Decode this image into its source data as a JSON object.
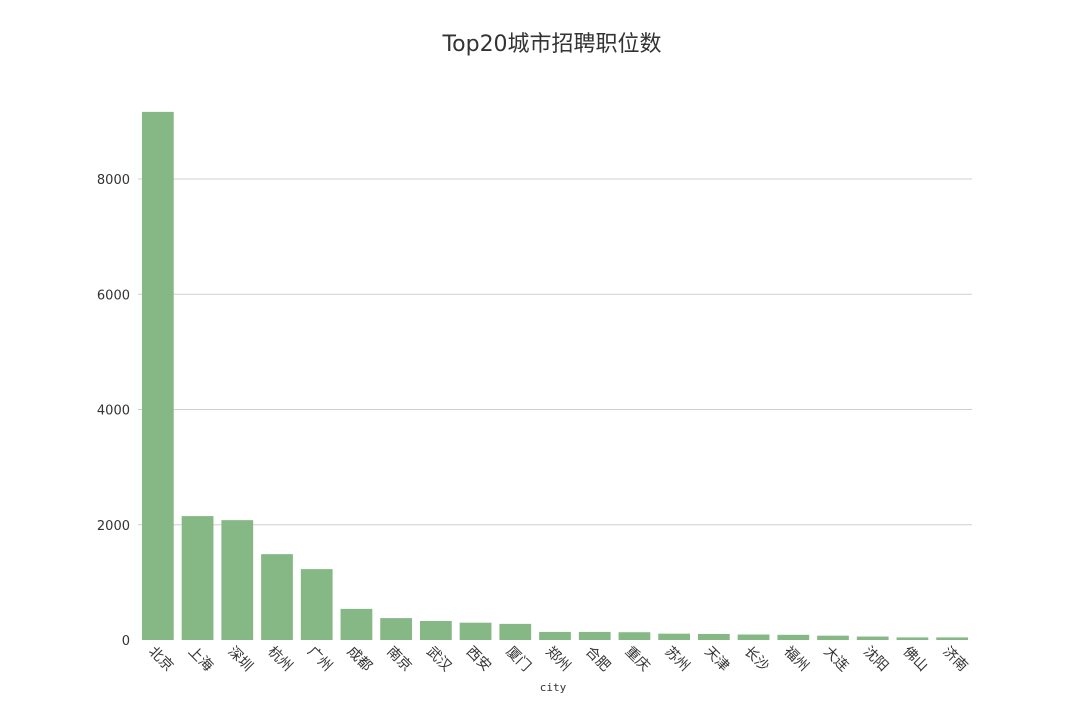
{
  "chart_data": {
    "type": "bar",
    "title": "Top20城市招聘职位数",
    "xlabel": "city",
    "ylabel": "",
    "ylim": [
      0,
      9200
    ],
    "yticks": [
      0,
      2000,
      4000,
      6000,
      8000
    ],
    "grid": true,
    "bar_color": "#86b886",
    "categories": [
      "北京",
      "上海",
      "深圳",
      "杭州",
      "广州",
      "成都",
      "南京",
      "武汉",
      "西安",
      "厦门",
      "郑州",
      "合肥",
      "重庆",
      "苏州",
      "天津",
      "长沙",
      "福州",
      "大连",
      "沈阳",
      "佛山",
      "济南"
    ],
    "values": [
      9165,
      2150,
      2080,
      1490,
      1230,
      540,
      380,
      330,
      300,
      280,
      140,
      140,
      135,
      110,
      105,
      95,
      90,
      75,
      60,
      45,
      45
    ]
  }
}
